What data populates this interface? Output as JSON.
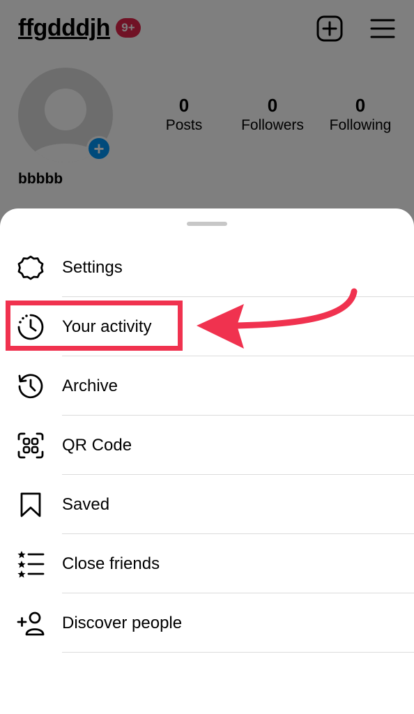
{
  "profile": {
    "username": "ffgdddjh",
    "notification_badge": "9+",
    "display_name": "bbbbb",
    "stats": [
      {
        "value": "0",
        "label": "Posts"
      },
      {
        "value": "0",
        "label": "Followers"
      },
      {
        "value": "0",
        "label": "Following"
      }
    ]
  },
  "icons": {
    "create": "plus-square-icon",
    "menu": "hamburger-menu-icon",
    "avatar_add": "plus-icon"
  },
  "menu": {
    "items": [
      {
        "label": "Settings",
        "icon": "settings-icon"
      },
      {
        "label": "Your activity",
        "icon": "activity-icon"
      },
      {
        "label": "Archive",
        "icon": "archive-icon"
      },
      {
        "label": "QR Code",
        "icon": "qr-code-icon"
      },
      {
        "label": "Saved",
        "icon": "bookmark-icon"
      },
      {
        "label": "Close friends",
        "icon": "close-friends-icon"
      },
      {
        "label": "Discover people",
        "icon": "add-person-icon"
      }
    ]
  },
  "colors": {
    "highlight": "#f0324f",
    "badge": "#e0254a",
    "accent": "#0095f6"
  }
}
